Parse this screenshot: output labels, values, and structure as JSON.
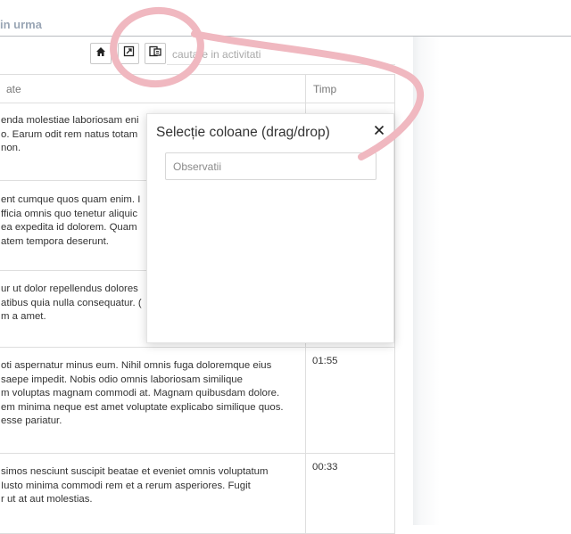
{
  "page": {
    "title": "in urma"
  },
  "toolbar": {
    "home_icon": "home-icon",
    "export_icon": "export-icon",
    "columns_icon": "columns-select-icon",
    "search_placeholder": "cautare in activitati"
  },
  "table": {
    "headers": [
      "ate",
      "Timp"
    ],
    "rows": [
      {
        "lines": [
          "enda molestiae laboriosam eni",
          "o. Earum odit rem natus totam",
          "non."
        ],
        "time": ""
      },
      {
        "lines": [
          "ent cumque quos quam enim. I",
          "fficia omnis quo tenetur aliquic",
          " ea expedita id dolorem. Quam",
          "atem tempora deserunt."
        ],
        "time": ""
      },
      {
        "lines": [
          "ur ut dolor repellendus dolores",
          "atibus quia nulla consequatur. (",
          "m a amet."
        ],
        "time": ""
      },
      {
        "lines": [
          "oti aspernatur minus eum. Nihil omnis fuga doloremque eius",
          " saepe impedit. Nobis odio omnis laboriosam similique",
          "m voluptas magnam commodi at. Magnam quibusdam dolore.",
          "em minima neque est amet voluptate explicabo similique quos.",
          " esse pariatur."
        ],
        "time": "01:55"
      },
      {
        "lines": [
          "simos nesciunt suscipit beatae et eveniet omnis voluptatum",
          " Iusto minima commodi rem et a rerum asperiores. Fugit",
          "r ut at aut molestias."
        ],
        "time": "00:33"
      }
    ]
  },
  "modal": {
    "title": "Selecție coloane (drag/drop)",
    "close_icon": "close-icon",
    "columns": [
      "Observatii"
    ]
  },
  "colors": {
    "annotation": "#f0b8c0",
    "accent_text": "#9aa6b5"
  }
}
